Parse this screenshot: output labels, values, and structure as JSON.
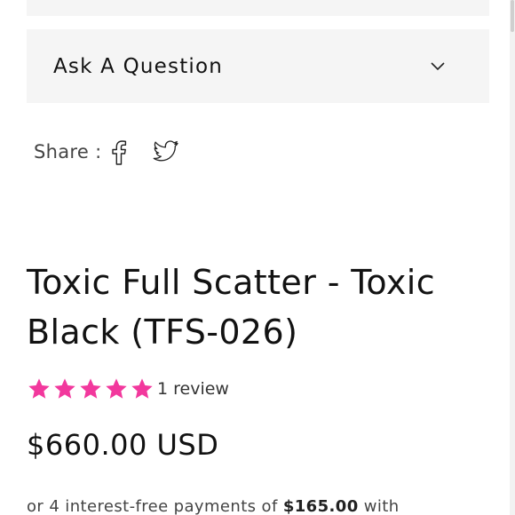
{
  "accordion": {
    "title": "Ask A Question"
  },
  "share": {
    "label": "Share :",
    "icons": [
      "facebook-icon",
      "twitter-icon"
    ]
  },
  "product": {
    "title": "Toxic Full Scatter - Toxic Black (TFS-026)",
    "rating": 5,
    "review_count": "1 review",
    "price": "$660.00 USD",
    "installments": {
      "prefix": "or 4 interest-free payments of ",
      "amount": "$165.00",
      "suffix": " with"
    }
  },
  "colors": {
    "star": "#f2389d",
    "panel": "#f5f5f5",
    "text": "#121212"
  }
}
